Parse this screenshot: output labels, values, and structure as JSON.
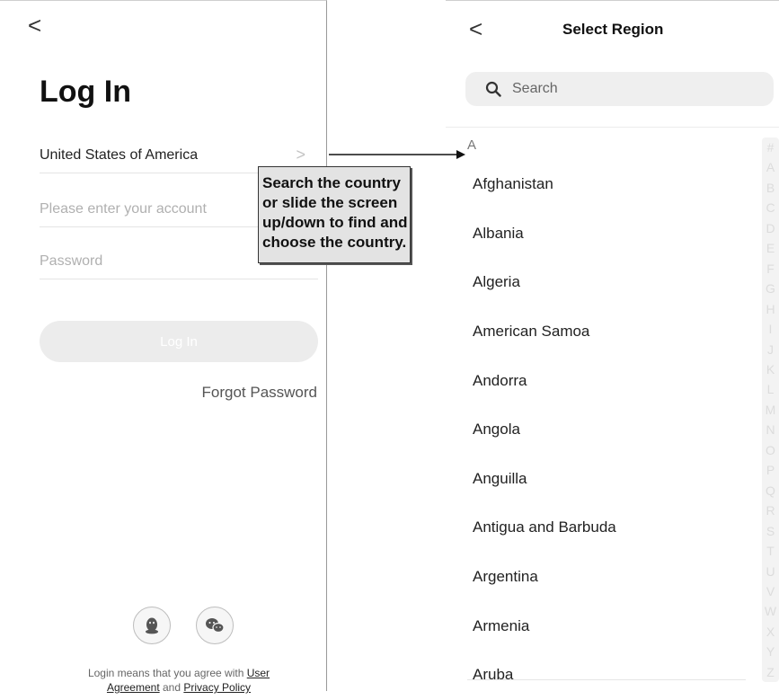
{
  "login": {
    "back_glyph": "<",
    "title": "Log In",
    "region": "United States of America",
    "region_chevron": ">",
    "account_placeholder": "Please enter your account",
    "password_placeholder": "Password",
    "login_button": "Log In",
    "forgot_password": "Forgot Password",
    "agreement_prefix": "Login means that you agree with ",
    "agreement_user_1": "User",
    "agreement_user_2": "Agreement",
    "agreement_and": " and ",
    "agreement_privacy": "Privacy Policy",
    "social_icons": [
      "qq-icon",
      "wechat-icon"
    ]
  },
  "callout": {
    "lines": [
      "Search the country",
      "or slide the screen",
      "up/down to find and",
      "choose the country."
    ]
  },
  "region": {
    "back_glyph": "<",
    "title": "Select Region",
    "search_placeholder": "Search",
    "section_letter": "A",
    "countries": [
      "Afghanistan",
      "Albania",
      "Algeria",
      "American Samoa",
      "Andorra",
      "Angola",
      "Anguilla",
      "Antigua and Barbuda",
      "Argentina",
      "Armenia",
      "Aruba"
    ],
    "index_letters": [
      "#",
      "A",
      "B",
      "C",
      "D",
      "E",
      "F",
      "G",
      "H",
      "I",
      "J",
      "K",
      "L",
      "M",
      "N",
      "O",
      "P",
      "Q",
      "R",
      "S",
      "T",
      "U",
      "V",
      "W",
      "X",
      "Y",
      "Z"
    ]
  },
  "colors": {
    "login_button_bg": "#ececec",
    "callout_bg": "#e3e3e3",
    "search_bg": "#efefef",
    "index_bar_bg": "#f3f3f3"
  }
}
